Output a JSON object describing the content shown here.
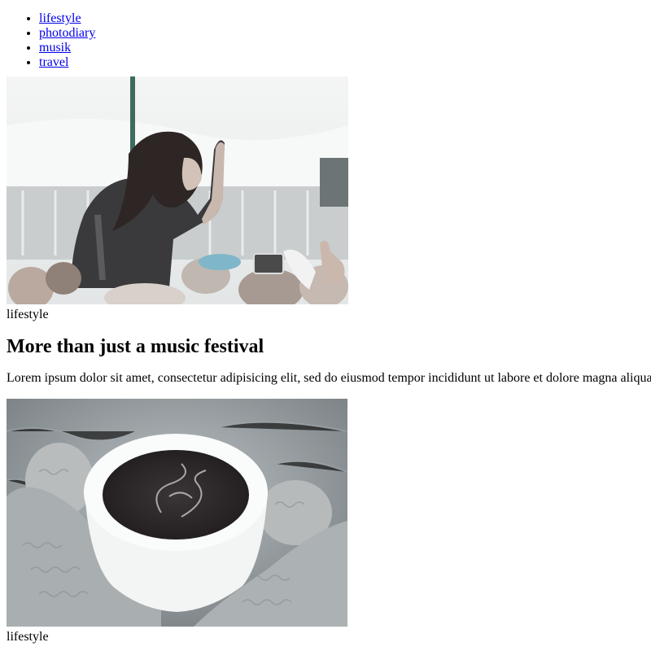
{
  "nav": {
    "items": [
      {
        "label": "lifestyle"
      },
      {
        "label": "photodiary"
      },
      {
        "label": "musik"
      },
      {
        "label": "travel"
      }
    ]
  },
  "posts": [
    {
      "image_icon": "festival-crowd-photo",
      "category": "lifestyle",
      "title": "More than just a music festival",
      "excerpt": "Lorem ipsum dolor sit amet, consectetur adipisicing elit, sed do eiusmod tempor incididunt ut labore et dolore magna aliqua."
    },
    {
      "image_icon": "coffee-cup-photo",
      "category": "lifestyle"
    }
  ],
  "colors": {
    "link": "#0000ee",
    "text": "#000000",
    "background": "#ffffff"
  }
}
